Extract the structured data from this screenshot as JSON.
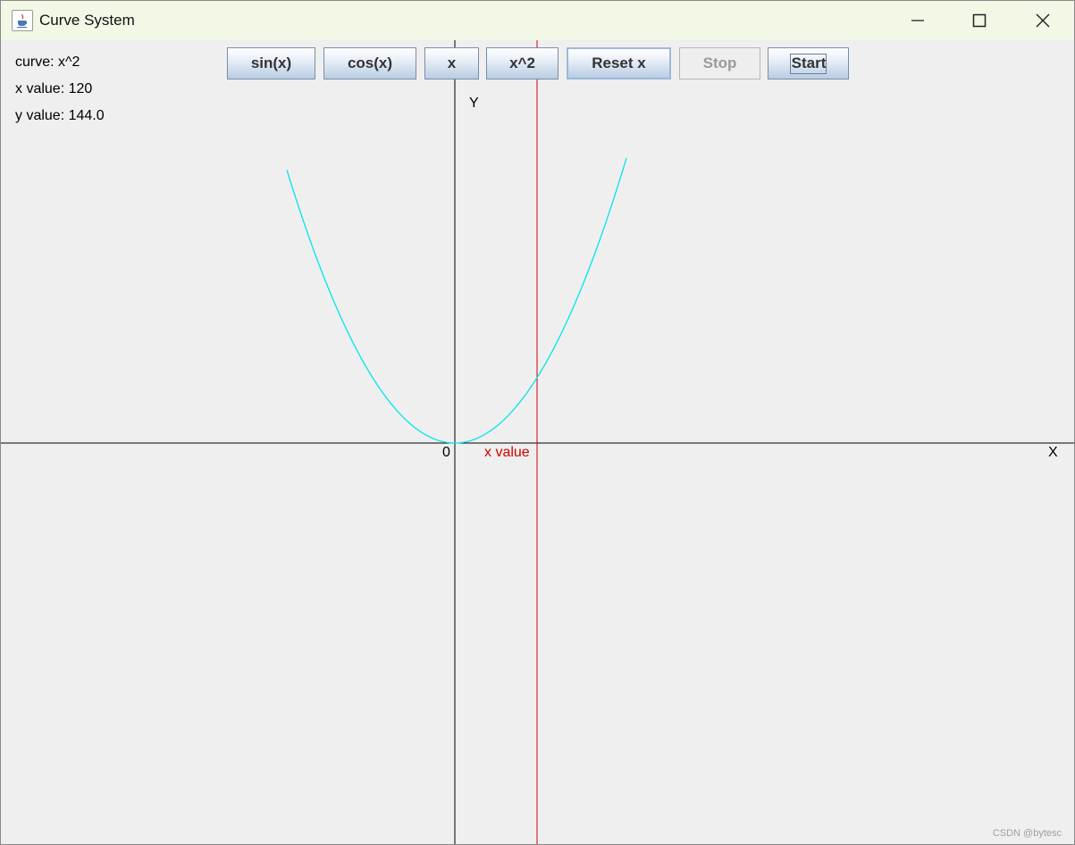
{
  "window": {
    "title": "Curve System"
  },
  "info": {
    "curve_text": "curve: x^2",
    "x_value_text": "x value: 120",
    "y_value_text": "y value: 144.0"
  },
  "buttons": {
    "sin": "sin(x)",
    "cos": "cos(x)",
    "x": "x",
    "x2": "x^2",
    "reset": "Reset x",
    "stop": "Stop",
    "start": "Start"
  },
  "plot": {
    "origin_label": "0",
    "x_axis_label": "X",
    "y_axis_label": "Y",
    "x_marker_label": "x value",
    "curve_color": "#00e5ee",
    "marker_color": "#d00000",
    "axis_color": "#000000"
  },
  "watermark": "CSDN @bytesc",
  "icons": {
    "app": "java-coffee-cup-icon",
    "minimize": "minimize-icon",
    "maximize": "maximize-icon",
    "close": "close-icon"
  }
}
